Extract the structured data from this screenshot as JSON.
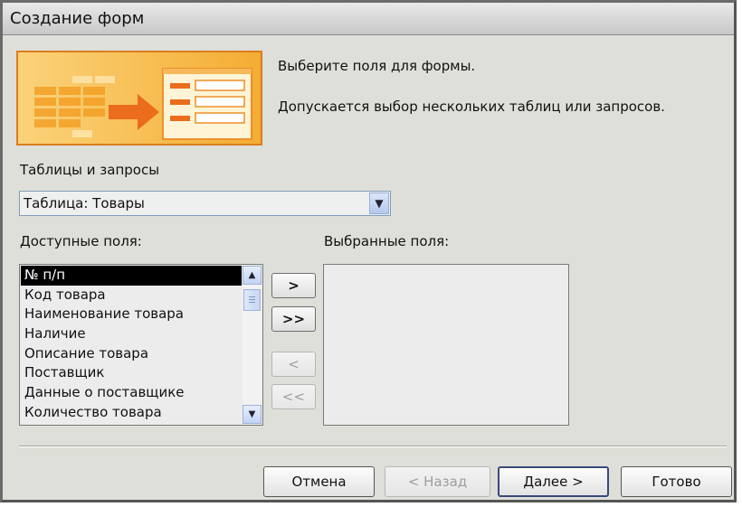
{
  "window": {
    "title": "Создание форм"
  },
  "intro": {
    "line1": "Выберите поля для формы.",
    "line2": "Допускается выбор нескольких таблиц или запросов."
  },
  "source": {
    "label": "Таблицы и запросы",
    "selected": "Таблица: Товары"
  },
  "available": {
    "label": "Доступные поля:",
    "items": [
      "№ п/п",
      "Код товара",
      "Наименование товара",
      "Наличие",
      "Описание товара",
      "Поставщик",
      "Данные о поставщике",
      "Количество товара"
    ]
  },
  "selected_fields": {
    "label": "Выбранные поля:"
  },
  "move_buttons": {
    "add_one": ">",
    "add_all": ">>",
    "remove_one": "<",
    "remove_all": "<<"
  },
  "buttons": {
    "cancel": "Отмена",
    "back": "< Назад",
    "next": "Далее >",
    "finish": "Готово"
  }
}
